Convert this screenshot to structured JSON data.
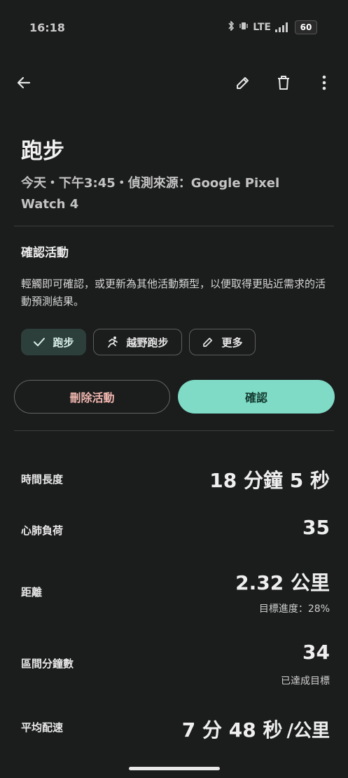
{
  "status_bar": {
    "time": "16:18",
    "network": "LTE",
    "battery": "60"
  },
  "header": {
    "back_icon": "arrow-left-icon",
    "edit_icon": "pencil-icon",
    "delete_icon": "trash-icon",
    "more_icon": "more-vert-icon"
  },
  "activity": {
    "title": "跑步",
    "subtitle": "今天・下午3:45・偵測來源：Google Pixel Watch 4"
  },
  "confirm_section": {
    "title": "確認活動",
    "description": "輕觸即可確認，或更新為其他活動類型，以便取得更貼近需求的活動預測結果。",
    "chips": [
      {
        "label": "跑步",
        "icon": "check-icon",
        "selected": true
      },
      {
        "label": "越野跑步",
        "icon": "running-figure-icon",
        "selected": false
      },
      {
        "label": "更多",
        "icon": "pencil-icon",
        "selected": false
      }
    ],
    "delete_label": "刪除活動",
    "confirm_label": "確認"
  },
  "metrics": {
    "duration": {
      "label": "時間長度",
      "value": "18 分鐘 5 秒"
    },
    "cardio_load": {
      "label": "心肺負荷",
      "value": "35"
    },
    "distance": {
      "label": "距離",
      "value": "2.32 公里",
      "sub": "目標進度：28%"
    },
    "zone_minutes": {
      "label": "區間分鐘數",
      "value": "34",
      "sub": "已達成目標"
    },
    "pace": {
      "label": "平均配速",
      "value": "7 分 48 秒",
      "unit": "/公里"
    }
  },
  "colors": {
    "background": "#1b1c1c",
    "accent": "#7fdbc6",
    "chip_selected": "#2c3f3b",
    "delete_text": "#f2b8b0"
  }
}
